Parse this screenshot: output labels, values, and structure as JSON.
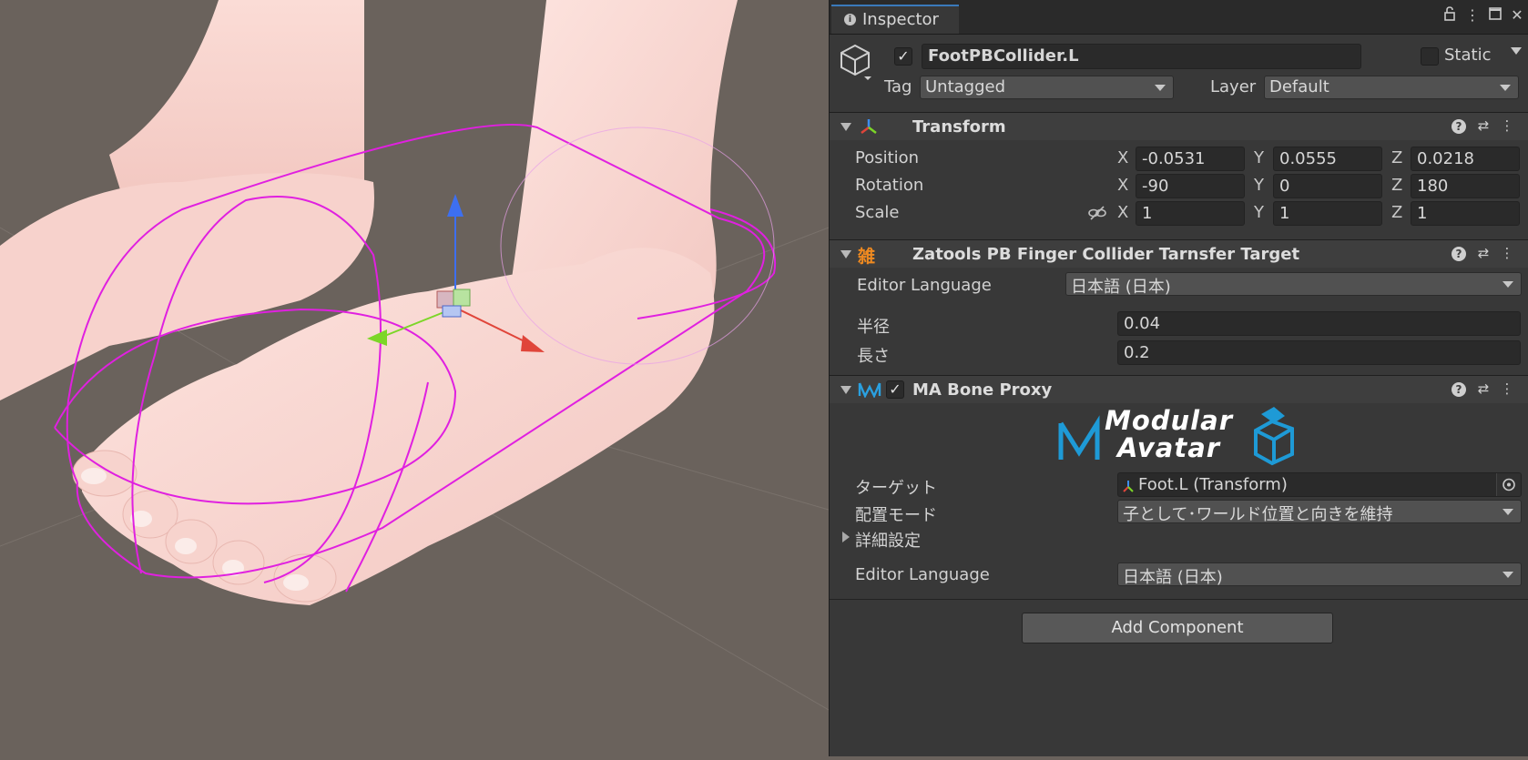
{
  "inspector": {
    "tab_label": "Inspector",
    "icons": {
      "tab": "info-icon",
      "lock": "lock-icon",
      "menu": "kebab-menu-icon",
      "maximize": "maximize-icon",
      "close": "close-icon"
    }
  },
  "gameobject": {
    "active": true,
    "name": "FootPBCollider.L",
    "static_label": "Static",
    "static_checked": false,
    "tag_label": "Tag",
    "tag_value": "Untagged",
    "layer_label": "Layer",
    "layer_value": "Default"
  },
  "transform": {
    "title": "Transform",
    "rows": [
      {
        "label": "Position",
        "x": "-0.0531",
        "y": "0.0555",
        "z": "0.0218"
      },
      {
        "label": "Rotation",
        "x": "-90",
        "y": "0",
        "z": "180"
      },
      {
        "label": "Scale",
        "x": "1",
        "y": "1",
        "z": "1"
      }
    ],
    "axis_labels": [
      "X",
      "Y",
      "Z"
    ]
  },
  "zatools": {
    "icon_glyph": "雑",
    "title": "Zatools PB Finger Collider Tarnsfer Target",
    "editor_language_label": "Editor Language",
    "editor_language_value": "日本語 (日本)",
    "radius_label": "半径",
    "radius_value": "0.04",
    "length_label": "長さ",
    "length_value": "0.2"
  },
  "bone_proxy": {
    "enabled": true,
    "title": "MA Bone Proxy",
    "logo_line1": "Modular",
    "logo_line2": "Avatar",
    "target_label": "ターゲット",
    "target_value": "Foot.L (Transform)",
    "placement_label": "配置モード",
    "placement_value": "子として･ワールド位置と向きを維持",
    "advanced_label": "詳細設定",
    "editor_language_label": "Editor Language",
    "editor_language_value": "日本語 (日本)"
  },
  "add_component_label": "Add Component",
  "colors": {
    "panel": "#383838",
    "header": "#3e3e3e",
    "field": "#2a2a2a",
    "accent_blue": "#3a79bb",
    "gizmo_magenta": "#e020e0",
    "axis_x": "#e0453a",
    "axis_y": "#7cd628",
    "axis_z": "#3d6ff0"
  }
}
